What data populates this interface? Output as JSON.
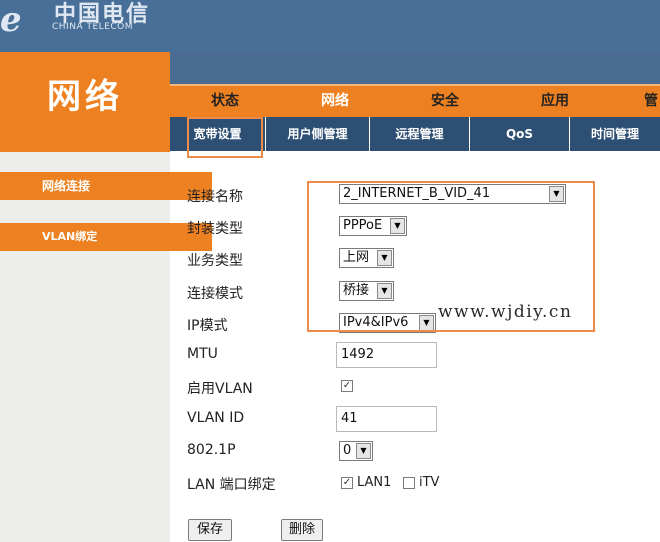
{
  "header": {
    "logo_mark": "ℯ",
    "logo_cn": "中国电信",
    "logo_en": "CHINA TELECOM",
    "section_title": "网络"
  },
  "main_nav": [
    "状态",
    "网络",
    "安全",
    "应用",
    "管"
  ],
  "sub_nav": [
    "宽带设置",
    "用户侧管理",
    "远程管理",
    "QoS",
    "时间管理"
  ],
  "sidebar": [
    "网络连接",
    "VLAN绑定"
  ],
  "form": {
    "connection_name": {
      "label": "连接名称",
      "value": "2_INTERNET_B_VID_41"
    },
    "encapsulation": {
      "label": "封装类型",
      "value": "PPPoE"
    },
    "service_type": {
      "label": "业务类型",
      "value": "上网"
    },
    "connection_mode": {
      "label": "连接模式",
      "value": "桥接"
    },
    "ip_mode": {
      "label": "IP模式",
      "value": "IPv4&IPv6"
    },
    "mtu": {
      "label": "MTU",
      "value": "1492"
    },
    "enable_vlan": {
      "label": "启用VLAN",
      "checked": true
    },
    "vlan_id": {
      "label": "VLAN ID",
      "value": "41"
    },
    "dot1p": {
      "label": "802.1P",
      "value": "0"
    },
    "lan_binding": {
      "label": "LAN 端口绑定",
      "lan1_label": "LAN1",
      "lan1_checked": true,
      "itv_label": "iTV",
      "itv_checked": false
    }
  },
  "buttons": {
    "save": "保存",
    "delete": "删除"
  },
  "watermark": "www.wjdiy.cn",
  "colors": {
    "orange": "#ed8121",
    "header_blue": "#486f98",
    "subnav_blue": "#2e4f74",
    "highlight": "#ee8a4a"
  }
}
